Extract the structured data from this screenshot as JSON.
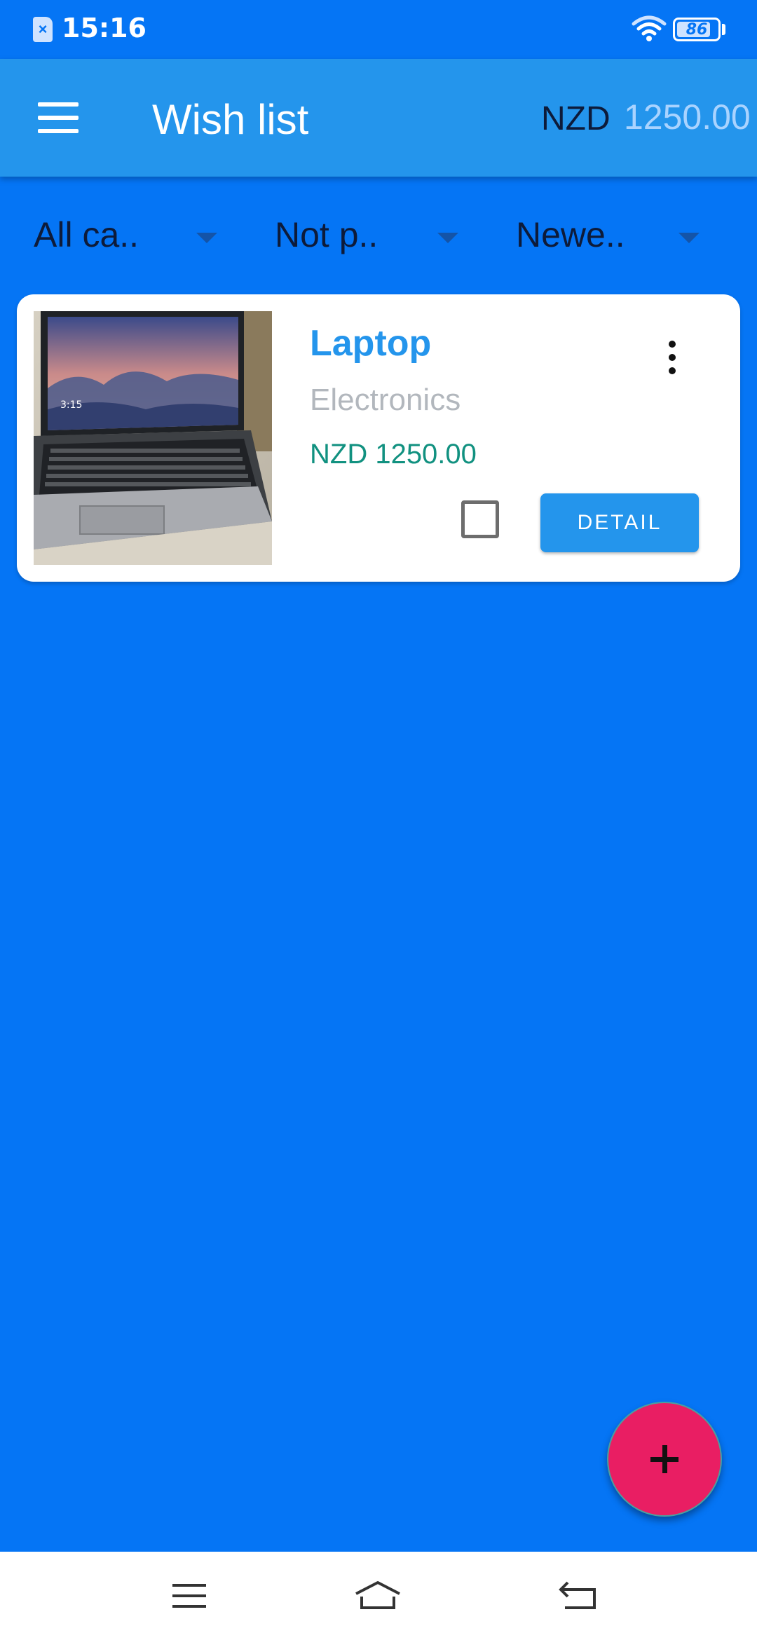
{
  "status_bar": {
    "time": "15:16",
    "battery_level": "86",
    "icons": [
      "sim-icon",
      "wifi-icon",
      "battery-icon"
    ]
  },
  "app_bar": {
    "title": "Wish list",
    "currency": "NZD",
    "total": "1250.00"
  },
  "filters": [
    {
      "label": "All ca.."
    },
    {
      "label": "Not p.."
    },
    {
      "label": "Newe.."
    }
  ],
  "items": [
    {
      "name": "Laptop",
      "category": "Electronics",
      "price": "NZD 1250.00",
      "checked": false,
      "detail_label": "DETAIL",
      "photo_clock": "3:15"
    }
  ],
  "fab": {
    "icon": "plus-icon"
  },
  "nav_bar": {
    "icons": [
      "menu-icon",
      "home-icon",
      "back-icon"
    ]
  },
  "colors": {
    "background": "#0575F5",
    "app_bar": "#2495EC",
    "accent_title": "#2495EC",
    "price": "#119180",
    "fab": "#E91E63"
  }
}
